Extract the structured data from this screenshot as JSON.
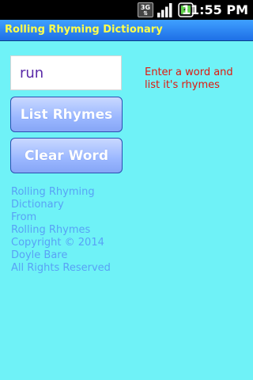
{
  "status_bar": {
    "network_label": "3G",
    "time": "11:55",
    "time_suffix": "PM"
  },
  "app": {
    "title": "Rolling Rhyming Dictionary"
  },
  "form": {
    "word_value": "run",
    "list_button": "List Rhymes",
    "clear_button": "Clear Word"
  },
  "hint": "Enter a word and list it's rhymes",
  "credits": {
    "line1": "Rolling Rhyming",
    "line2": "Dictionary",
    "line3": "From",
    "line4": "Rolling Rhymes",
    "line5": "Copyright © 2014",
    "line6": "Doyle Bare",
    "line7": "All Rights Reserved"
  },
  "colors": {
    "background": "#6ff2f7",
    "title_bar": "#2a84f2",
    "title_text": "#ffff4a",
    "hint_text": "#e0190f",
    "credits_text": "#58a2f6"
  },
  "icons": {
    "network": "3g-data-icon",
    "signal": "signal-strength-icon",
    "battery": "battery-charging-icon"
  }
}
